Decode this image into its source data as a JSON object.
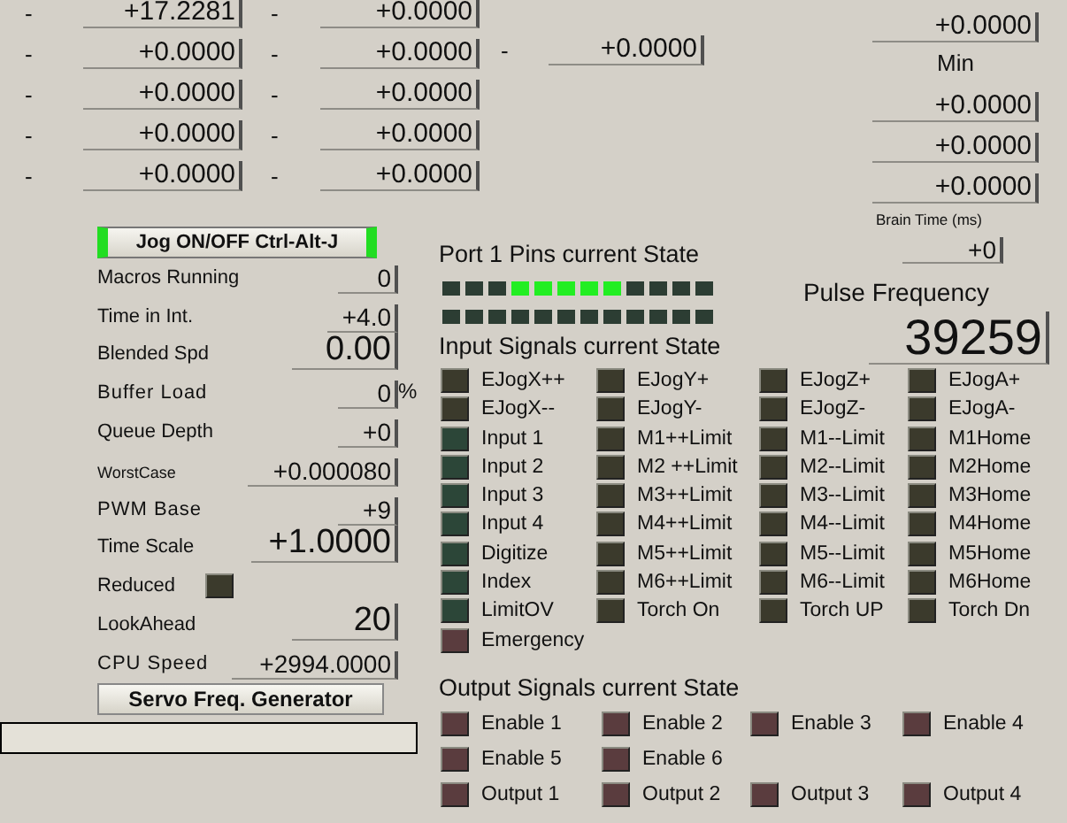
{
  "axis_rows": [
    {
      "cells": [
        {
          "dash": "-",
          "value": "+17.2281"
        },
        {
          "dash": "-",
          "value": "+0.0000"
        }
      ]
    },
    {
      "cells": [
        {
          "dash": "-",
          "value": "+0.0000"
        },
        {
          "dash": "-",
          "value": "+0.0000"
        }
      ]
    },
    {
      "cells": [
        {
          "dash": "-",
          "value": "+0.0000"
        },
        {
          "dash": "-",
          "value": "+0.0000"
        }
      ]
    },
    {
      "cells": [
        {
          "dash": "-",
          "value": "+0.0000"
        },
        {
          "dash": "-",
          "value": "+0.0000"
        }
      ]
    },
    {
      "cells": [
        {
          "dash": "-",
          "value": "+0.0000"
        },
        {
          "dash": "-",
          "value": "+0.0000"
        }
      ]
    }
  ],
  "extra_field": {
    "dash": "-",
    "value": "+0.0000"
  },
  "right_column": [
    {
      "kind": "field",
      "value": "+0.0000"
    },
    {
      "kind": "label",
      "text": "Min"
    },
    {
      "kind": "field",
      "value": "+0.0000"
    },
    {
      "kind": "field",
      "value": "+0.0000"
    },
    {
      "kind": "field",
      "value": "+0.0000"
    },
    {
      "kind": "caption",
      "text": "Brain Time (ms)"
    },
    {
      "kind": "small_field",
      "value": "+0"
    }
  ],
  "jog_button": {
    "label": "Jog ON/OFF Ctrl-Alt-J",
    "on": true
  },
  "stats": [
    {
      "kind": "value",
      "label": "Macros Running",
      "value": "0"
    },
    {
      "kind": "value",
      "label": "Time in Int.",
      "value": "+4.0"
    },
    {
      "kind": "large_value",
      "label": "Blended Spd",
      "value": "0.00"
    },
    {
      "kind": "value",
      "label": "Buffer Load",
      "value": "0",
      "unit": "%"
    },
    {
      "kind": "value",
      "label": "Queue Depth",
      "value": "+0"
    },
    {
      "kind": "small_label_value",
      "label": "WorstCase",
      "value": "+0.000080"
    },
    {
      "kind": "value",
      "label": "PWM Base",
      "value": "+9"
    },
    {
      "kind": "large_value",
      "label": "Time Scale",
      "value": "+1.0000"
    },
    {
      "kind": "led",
      "label": "Reduced",
      "on": false
    },
    {
      "kind": "large_value",
      "label": "LookAhead",
      "value": "20"
    },
    {
      "kind": "value",
      "label": "CPU Speed",
      "value": "+2994.0000"
    }
  ],
  "servo_button": {
    "label": "Servo Freq. Generator"
  },
  "port_title": "Port 1 Pins current State",
  "port_pin_rows": [
    {
      "pins": [
        {
          "on": false
        },
        {
          "on": false
        },
        {
          "on": false
        },
        {
          "on": true
        },
        {
          "on": true
        },
        {
          "on": true
        },
        {
          "on": true
        },
        {
          "on": true
        },
        {
          "on": false
        },
        {
          "on": false
        },
        {
          "on": false
        },
        {
          "on": false
        }
      ]
    },
    {
      "pins": [
        {
          "on": false
        },
        {
          "on": false
        },
        {
          "on": false
        },
        {
          "on": false
        },
        {
          "on": false
        },
        {
          "on": false
        },
        {
          "on": false
        },
        {
          "on": false
        },
        {
          "on": false
        },
        {
          "on": false
        },
        {
          "on": false
        },
        {
          "on": false
        }
      ]
    }
  ],
  "pulse_label": "Pulse Frequency",
  "pulse_value": "39259",
  "input_title": "Input Signals current State",
  "inputs": [
    {
      "label": "EJogX++",
      "color": "#3b3a2c"
    },
    {
      "label": "EJogY+",
      "color": "#3b3a2c"
    },
    {
      "label": "EJogZ+",
      "color": "#3b3a2c"
    },
    {
      "label": "EJogA+",
      "color": "#3b3a2c"
    },
    {
      "label": "EJogX--",
      "color": "#3b3a2c"
    },
    {
      "label": "EJogY-",
      "color": "#3b3a2c"
    },
    {
      "label": "EJogZ-",
      "color": "#3b3a2c"
    },
    {
      "label": "EJogA-",
      "color": "#3b3a2c"
    },
    {
      "label": "Input 1",
      "color": "#2c4638"
    },
    {
      "label": "M1++Limit",
      "color": "#3b3a2c"
    },
    {
      "label": "M1--Limit",
      "color": "#3b3a2c"
    },
    {
      "label": "M1Home",
      "color": "#3b3a2c"
    },
    {
      "label": "Input 2",
      "color": "#2c4638"
    },
    {
      "label": "M2 ++Limit",
      "color": "#3b3a2c"
    },
    {
      "label": "M2--Limit",
      "color": "#3b3a2c"
    },
    {
      "label": "M2Home",
      "color": "#3b3a2c"
    },
    {
      "label": "Input 3",
      "color": "#2c4638"
    },
    {
      "label": "M3++Limit",
      "color": "#3b3a2c"
    },
    {
      "label": "M3--Limit",
      "color": "#3b3a2c"
    },
    {
      "label": "M3Home",
      "color": "#3b3a2c"
    },
    {
      "label": "Input 4",
      "color": "#2c4638"
    },
    {
      "label": "M4++Limit",
      "color": "#3b3a2c"
    },
    {
      "label": "M4--Limit",
      "color": "#3b3a2c"
    },
    {
      "label": "M4Home",
      "color": "#3b3a2c"
    },
    {
      "label": "Digitize",
      "color": "#2c4638"
    },
    {
      "label": "M5++Limit",
      "color": "#3b3a2c"
    },
    {
      "label": "M5--Limit",
      "color": "#3b3a2c"
    },
    {
      "label": "M5Home",
      "color": "#3b3a2c"
    },
    {
      "label": "Index",
      "color": "#2c4638"
    },
    {
      "label": "M6++Limit",
      "color": "#3b3a2c"
    },
    {
      "label": "M6--Limit",
      "color": "#3b3a2c"
    },
    {
      "label": "M6Home",
      "color": "#3b3a2c"
    },
    {
      "label": "LimitOV",
      "color": "#2c4638"
    },
    {
      "label": "Torch On",
      "color": "#3b3a2c"
    },
    {
      "label": "Torch UP",
      "color": "#3b3a2c"
    },
    {
      "label": "Torch Dn",
      "color": "#3b3a2c"
    },
    {
      "label": "Emergency",
      "color": "#5a3c3e"
    }
  ],
  "output_title": "Output Signals current State",
  "outputs": [
    {
      "label": "Enable 1"
    },
    {
      "label": "Enable 2"
    },
    {
      "label": "Enable 3"
    },
    {
      "label": "Enable 4"
    },
    {
      "label": "Enable 5"
    },
    {
      "label": "Enable 6"
    },
    {
      "label": "Output 1"
    },
    {
      "label": "Output 2"
    },
    {
      "label": "Output 3"
    },
    {
      "label": "Output 4"
    }
  ]
}
